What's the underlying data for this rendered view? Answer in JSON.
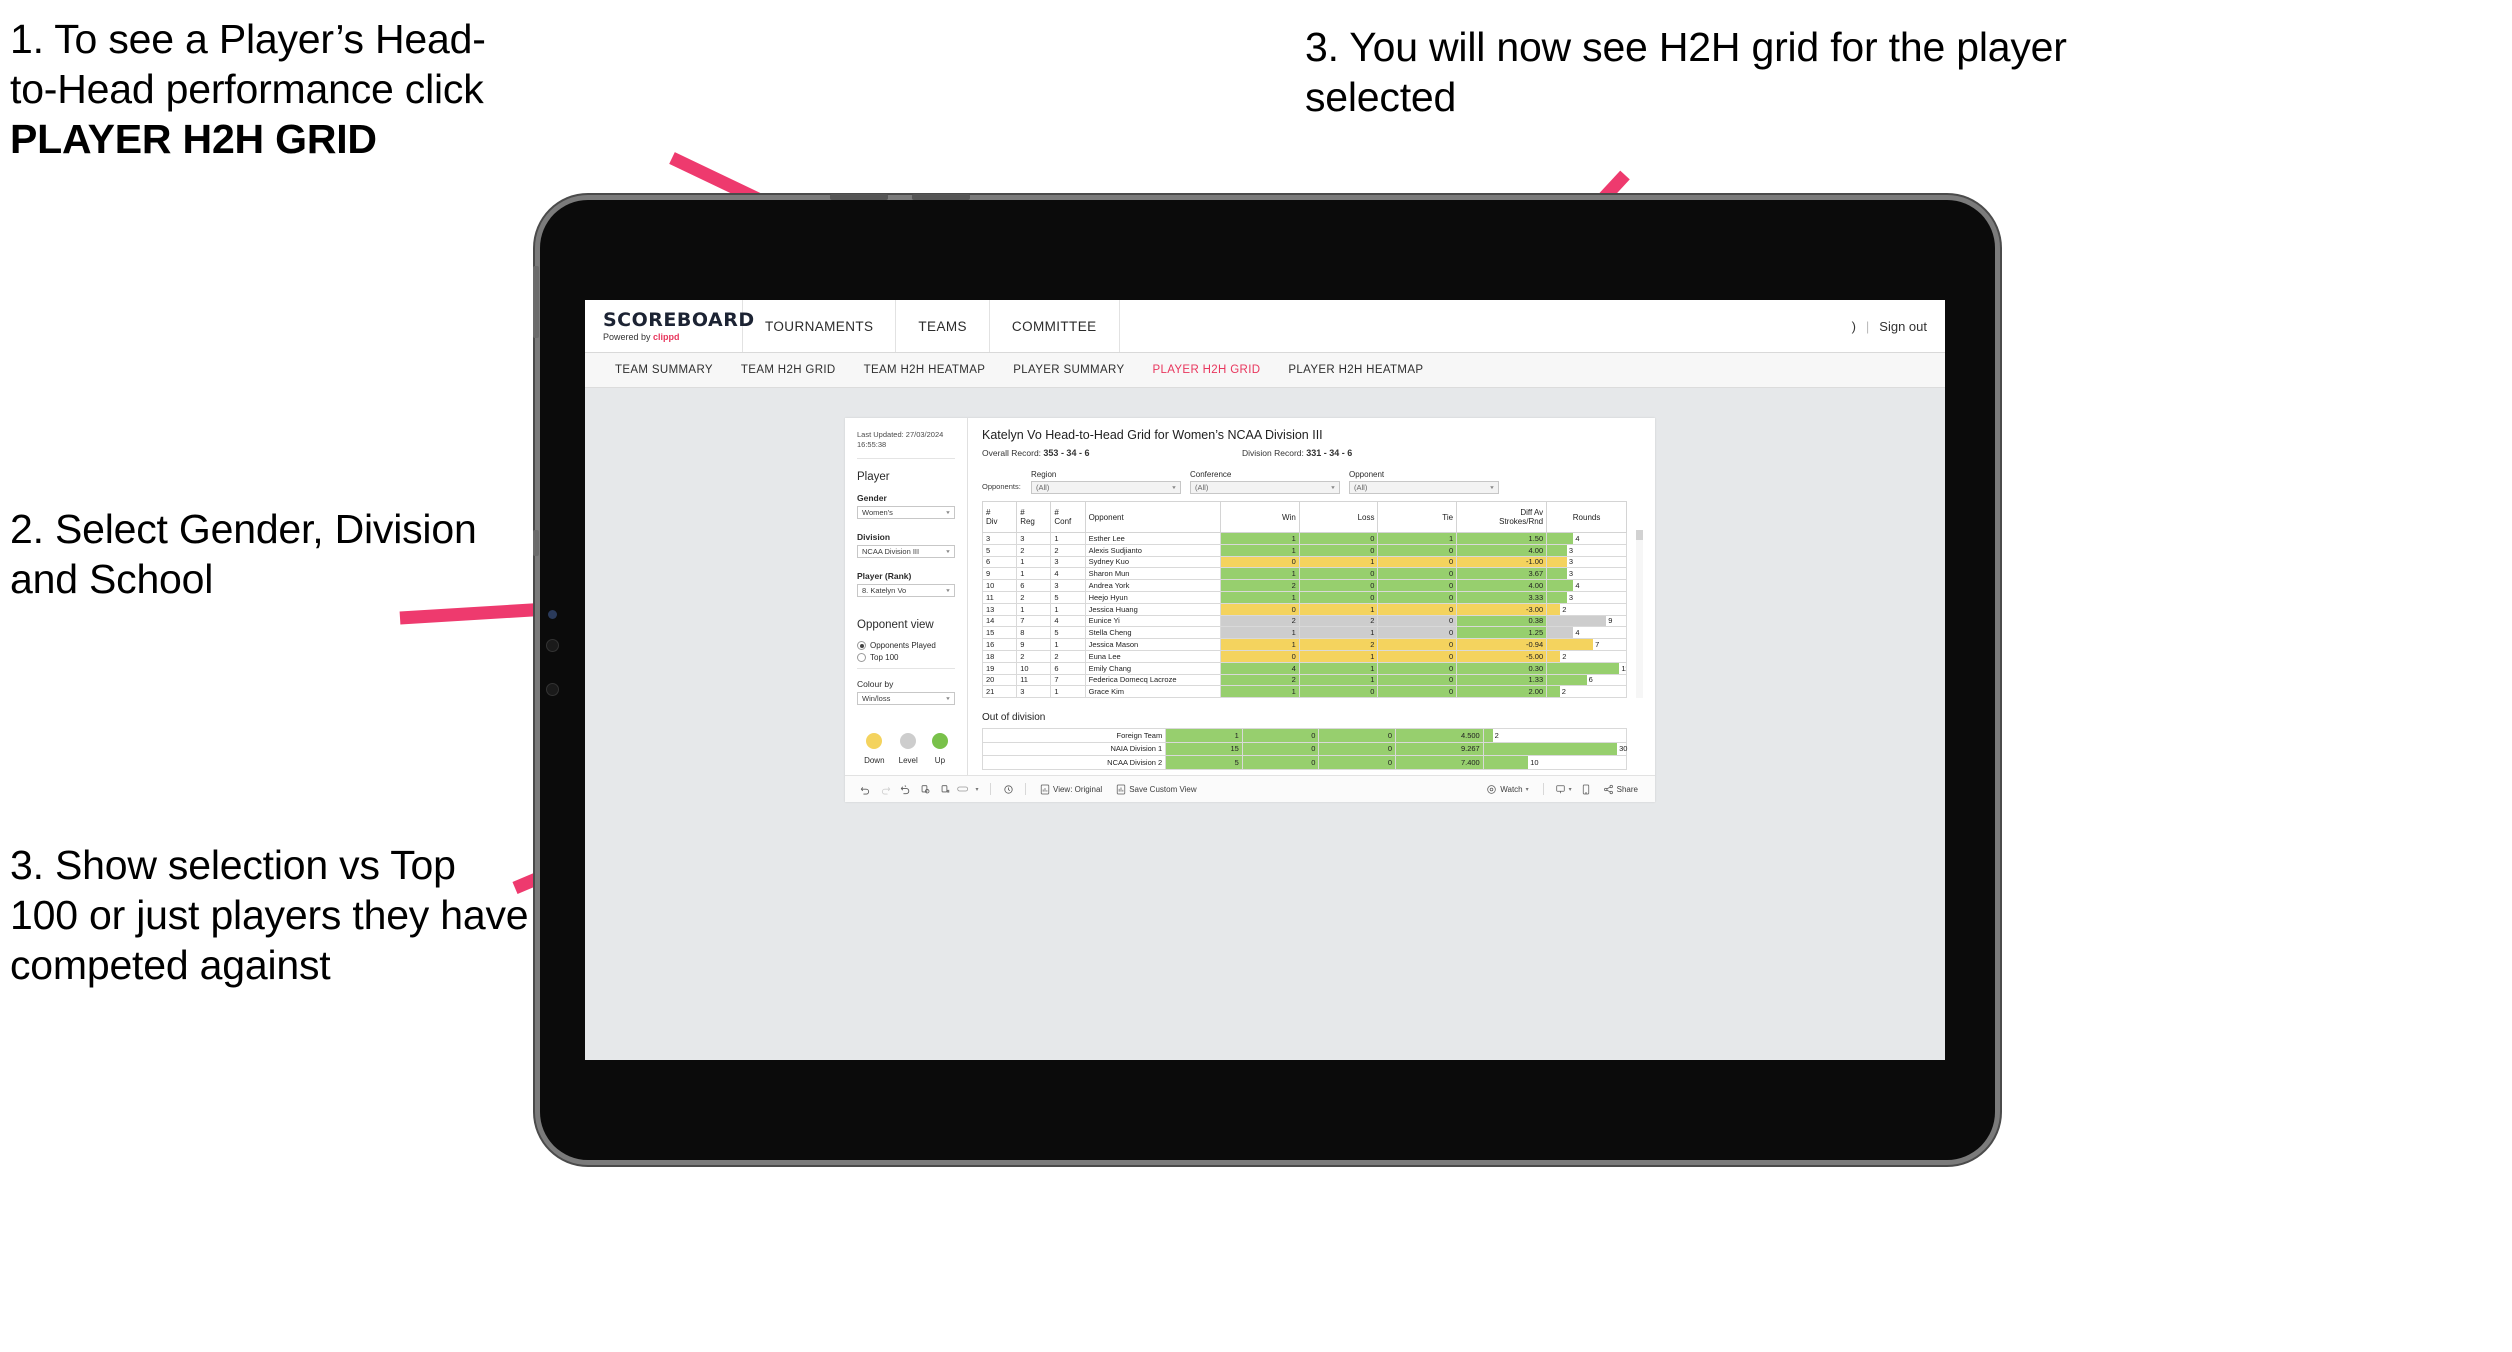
{
  "annotations": [
    {
      "id": "a1",
      "line1": "1. To see a Player’s Head-",
      "line2": "to-Head performance click",
      "line3": "PLAYER H2H GRID"
    },
    {
      "id": "a2",
      "text": "2. Select Gender, Division and School"
    },
    {
      "id": "a3",
      "text": "3. Show selection vs Top 100 or just players they have competed against"
    },
    {
      "id": "a4",
      "text": "3. You will now see H2H grid for the player selected"
    }
  ],
  "colors": {
    "accent_pink": "#e8365d",
    "arrow_pink": "#ee3a6e",
    "green": "#97cf6e",
    "yellow": "#f4d35e",
    "grey": "#cdcdcd"
  },
  "app": {
    "brand": {
      "name": "SCOREBOARD",
      "powered_prefix": "Powered by ",
      "powered_brand": "clippd"
    },
    "topnav": [
      {
        "label": "TOURNAMENTS"
      },
      {
        "label": "TEAMS"
      },
      {
        "label": "COMMITTEE"
      }
    ],
    "account": {
      "user_glyph": ")",
      "divider": "|",
      "sign_out": "Sign out"
    },
    "subnav": [
      {
        "label": "TEAM SUMMARY",
        "active": false
      },
      {
        "label": "TEAM H2H GRID",
        "active": false
      },
      {
        "label": "TEAM H2H HEATMAP",
        "active": false
      },
      {
        "label": "PLAYER SUMMARY",
        "active": false
      },
      {
        "label": "PLAYER H2H GRID",
        "active": true
      },
      {
        "label": "PLAYER H2H HEATMAP",
        "active": false
      }
    ]
  },
  "sidebar": {
    "last_updated": "Last Updated: 27/03/2024 16:55:38",
    "player_heading": "Player",
    "gender": {
      "label": "Gender",
      "value": "Women's"
    },
    "division": {
      "label": "Division",
      "value": "NCAA Division III"
    },
    "player_rank": {
      "label": "Player (Rank)",
      "value": "8. Katelyn Vo"
    },
    "opponent_view": {
      "heading": "Opponent view",
      "options": [
        {
          "label": "Opponents Played",
          "selected": true
        },
        {
          "label": "Top 100",
          "selected": false
        }
      ]
    },
    "colour_by": {
      "label": "Colour by",
      "value": "Win/loss"
    },
    "legend": [
      {
        "label": "Down",
        "color": "#f4d35e"
      },
      {
        "label": "Level",
        "color": "#cdcdcd"
      },
      {
        "label": "Up",
        "color": "#79c14a"
      }
    ]
  },
  "main": {
    "title": "Katelyn Vo Head-to-Head Grid for Women’s NCAA Division III",
    "overall_record_label": "Overall Record: ",
    "overall_record_value": "353 - 34 - 6",
    "division_record_label": "Division Record: ",
    "division_record_value": "331 - 34 - 6",
    "opponents_label": "Opponents:",
    "filters": [
      {
        "label": "Region",
        "value": "(All)"
      },
      {
        "label": "Conference",
        "value": "(All)"
      },
      {
        "label": "Opponent",
        "value": "(All)"
      }
    ],
    "out_of_division_title": "Out of division"
  },
  "chart_data": {
    "type": "table",
    "title": "Katelyn Vo Head-to-Head Grid for Women’s NCAA Division III",
    "columns": [
      "# Div",
      "# Reg",
      "# Conf",
      "Opponent",
      "Win",
      "Loss",
      "Tie",
      "Diff Av Strokes/Rnd",
      "Rounds"
    ],
    "column_header_lines": [
      [
        "#",
        "Div"
      ],
      [
        "#",
        "Reg"
      ],
      [
        "#",
        "Conf"
      ],
      [
        "Opponent"
      ],
      [
        "Win"
      ],
      [
        "Loss"
      ],
      [
        "Tie"
      ],
      [
        "Diff Av",
        "Strokes/Rnd"
      ],
      [
        "Rounds"
      ]
    ],
    "rounds_max": 12,
    "rows": [
      {
        "div": "3",
        "reg": "3",
        "conf": "1",
        "opponent": "Esther Lee",
        "win": "1",
        "loss": "0",
        "tie": "1",
        "diff": "1.50",
        "rounds": "4",
        "color": "green"
      },
      {
        "div": "5",
        "reg": "2",
        "conf": "2",
        "opponent": "Alexis Sudjianto",
        "win": "1",
        "loss": "0",
        "tie": "0",
        "diff": "4.00",
        "rounds": "3",
        "color": "green"
      },
      {
        "div": "6",
        "reg": "1",
        "conf": "3",
        "opponent": "Sydney Kuo",
        "win": "0",
        "loss": "1",
        "tie": "0",
        "diff": "-1.00",
        "rounds": "3",
        "color": "yellow"
      },
      {
        "div": "9",
        "reg": "1",
        "conf": "4",
        "opponent": "Sharon Mun",
        "win": "1",
        "loss": "0",
        "tie": "0",
        "diff": "3.67",
        "rounds": "3",
        "color": "green"
      },
      {
        "div": "10",
        "reg": "6",
        "conf": "3",
        "opponent": "Andrea York",
        "win": "2",
        "loss": "0",
        "tie": "0",
        "diff": "4.00",
        "rounds": "4",
        "color": "green"
      },
      {
        "div": "11",
        "reg": "2",
        "conf": "5",
        "opponent": "Heejo Hyun",
        "win": "1",
        "loss": "0",
        "tie": "0",
        "diff": "3.33",
        "rounds": "3",
        "color": "green"
      },
      {
        "div": "13",
        "reg": "1",
        "conf": "1",
        "opponent": "Jessica Huang",
        "win": "0",
        "loss": "1",
        "tie": "0",
        "diff": "-3.00",
        "rounds": "2",
        "color": "yellow"
      },
      {
        "div": "14",
        "reg": "7",
        "conf": "4",
        "opponent": "Eunice Yi",
        "win": "2",
        "loss": "2",
        "tie": "0",
        "diff": "0.38",
        "rounds": "9",
        "color": "grey",
        "diff_color": "green"
      },
      {
        "div": "15",
        "reg": "8",
        "conf": "5",
        "opponent": "Stella Cheng",
        "win": "1",
        "loss": "1",
        "tie": "0",
        "diff": "1.25",
        "rounds": "4",
        "color": "grey",
        "diff_color": "green"
      },
      {
        "div": "16",
        "reg": "9",
        "conf": "1",
        "opponent": "Jessica Mason",
        "win": "1",
        "loss": "2",
        "tie": "0",
        "diff": "-0.94",
        "rounds": "7",
        "color": "yellow"
      },
      {
        "div": "18",
        "reg": "2",
        "conf": "2",
        "opponent": "Euna Lee",
        "win": "0",
        "loss": "1",
        "tie": "0",
        "diff": "-5.00",
        "rounds": "2",
        "color": "yellow"
      },
      {
        "div": "19",
        "reg": "10",
        "conf": "6",
        "opponent": "Emily Chang",
        "win": "4",
        "loss": "1",
        "tie": "0",
        "diff": "0.30",
        "rounds": "11",
        "color": "green"
      },
      {
        "div": "20",
        "reg": "11",
        "conf": "7",
        "opponent": "Federica Domecq Lacroze",
        "win": "2",
        "loss": "1",
        "tie": "0",
        "diff": "1.33",
        "rounds": "6",
        "color": "green"
      }
    ],
    "out_of_division": {
      "rounds_max": 32,
      "rows": [
        {
          "name": "Foreign Team",
          "win": "1",
          "loss": "0",
          "tie": "0",
          "diff": "4.500",
          "rounds": "2",
          "color": "green"
        },
        {
          "name": "NAIA Division 1",
          "win": "15",
          "loss": "0",
          "tie": "0",
          "diff": "9.267",
          "rounds": "30",
          "color": "green"
        },
        {
          "name": "NCAA Division 2",
          "win": "5",
          "loss": "0",
          "tie": "0",
          "diff": "7.400",
          "rounds": "10",
          "color": "green"
        }
      ]
    }
  },
  "toolbar": {
    "icons": [
      "undo-icon",
      "redo-icon",
      "revert-icon",
      "refresh-data-icon",
      "pause-updates-icon",
      "alerts-icon"
    ],
    "dropdown_caret": "▾",
    "metrics_icon": "device-preview-icon",
    "view_original": "View: Original",
    "save_custom_view": "Save Custom View",
    "watch": "Watch",
    "share": "Share"
  }
}
